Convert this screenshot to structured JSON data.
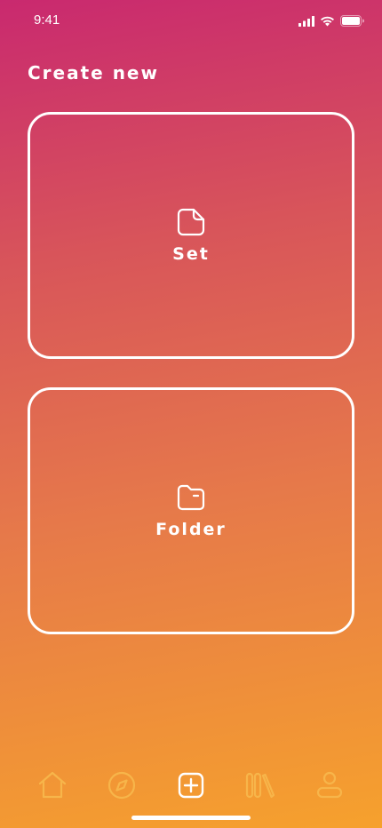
{
  "status_bar": {
    "time": "9:41"
  },
  "page": {
    "title": "Create new"
  },
  "cards": [
    {
      "label": "Set",
      "icon": "document-icon"
    },
    {
      "label": "Folder",
      "icon": "folder-icon"
    }
  ],
  "tab_bar": {
    "active": "create",
    "tabs": [
      {
        "id": "home",
        "icon": "home-icon"
      },
      {
        "id": "explore",
        "icon": "compass-icon"
      },
      {
        "id": "create",
        "icon": "plus-square-icon"
      },
      {
        "id": "library",
        "icon": "library-icon"
      },
      {
        "id": "profile",
        "icon": "profile-icon"
      }
    ]
  },
  "colors": {
    "gradient_top": "#c9296f",
    "gradient_bottom": "#f6a12d",
    "inactive_tab": "#f7b54a",
    "foreground": "#ffffff"
  }
}
